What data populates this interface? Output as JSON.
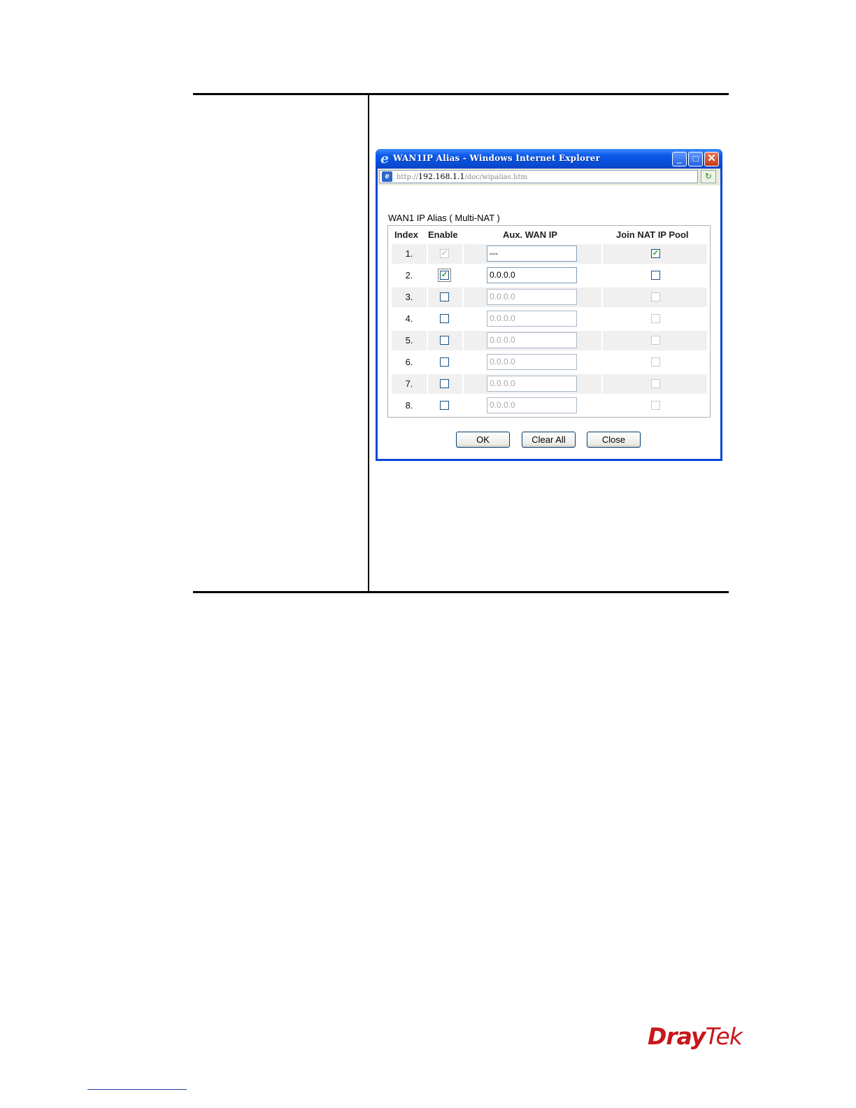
{
  "window": {
    "title": "WAN1IP Alias - Windows Internet Explorer",
    "minimize": "_",
    "maximize": "□",
    "close": "✕",
    "logo_glyph": "e"
  },
  "address_bar": {
    "prefix": "http://",
    "host": "192.168.1.1",
    "path": "/doc/wipalias.htm",
    "page_icon": "e",
    "go_icon": "↻"
  },
  "dialog": {
    "title": "WAN1 IP Alias ( Multi-NAT )",
    "headers": {
      "index": "Index",
      "enable": "Enable",
      "aux_wan_ip": "Aux. WAN IP",
      "join_nat": "Join NAT IP Pool"
    },
    "rows": [
      {
        "index": "1.",
        "enable": true,
        "enable_disabled": true,
        "ip": "---",
        "ip_dim": false,
        "join": true,
        "join_disabled": false
      },
      {
        "index": "2.",
        "enable": true,
        "enable_disabled": false,
        "ip": "0.0.0.0",
        "ip_dim": false,
        "join": false,
        "join_disabled": false
      },
      {
        "index": "3.",
        "enable": false,
        "enable_disabled": false,
        "ip": "0.0.0.0",
        "ip_dim": true,
        "join": false,
        "join_disabled": true
      },
      {
        "index": "4.",
        "enable": false,
        "enable_disabled": false,
        "ip": "0.0.0.0",
        "ip_dim": true,
        "join": false,
        "join_disabled": true
      },
      {
        "index": "5.",
        "enable": false,
        "enable_disabled": false,
        "ip": "0.0.0.0",
        "ip_dim": true,
        "join": false,
        "join_disabled": true
      },
      {
        "index": "6.",
        "enable": false,
        "enable_disabled": false,
        "ip": "0.0.0.0",
        "ip_dim": true,
        "join": false,
        "join_disabled": true
      },
      {
        "index": "7.",
        "enable": false,
        "enable_disabled": false,
        "ip": "0.0.0.0",
        "ip_dim": true,
        "join": false,
        "join_disabled": true
      },
      {
        "index": "8.",
        "enable": false,
        "enable_disabled": false,
        "ip": "0.0.0.0",
        "ip_dim": true,
        "join": false,
        "join_disabled": true
      }
    ],
    "buttons": {
      "ok": "OK",
      "clear_all": "Clear All",
      "close": "Close"
    }
  },
  "branding": {
    "logo_part1": "Dray",
    "logo_part2": "Tek"
  },
  "colors": {
    "brand_red": "#c8161d",
    "xp_blue": "#0a58e8",
    "check_green": "#21a121"
  }
}
